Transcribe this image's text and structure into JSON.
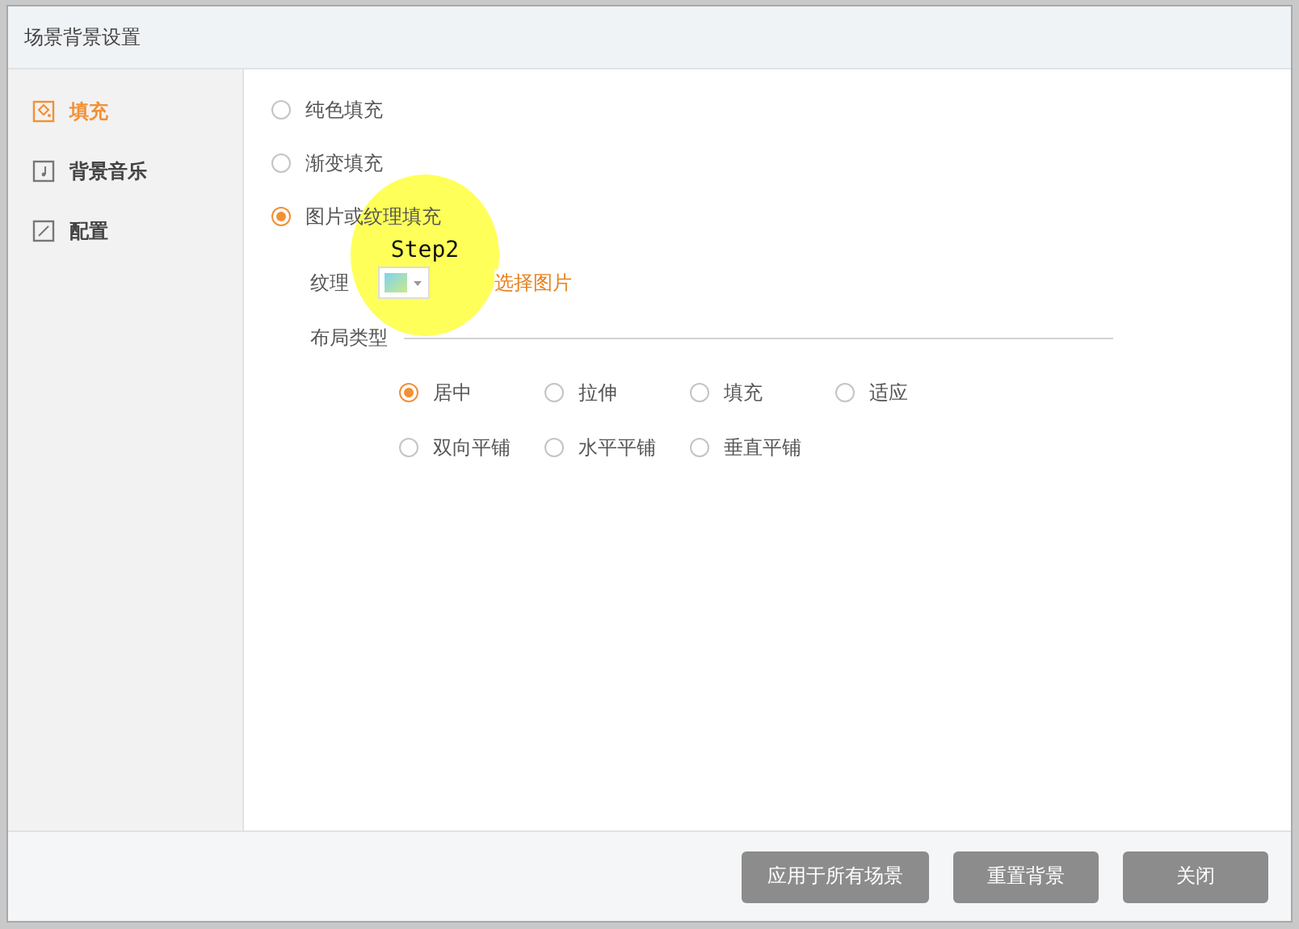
{
  "window": {
    "title": "场景背景设置"
  },
  "sidebar": {
    "items": [
      {
        "label": "填充",
        "selected": true
      },
      {
        "label": "背景音乐",
        "selected": false
      },
      {
        "label": "配置",
        "selected": false
      }
    ]
  },
  "fill_options": [
    {
      "label": "纯色填充",
      "selected": false
    },
    {
      "label": "渐变填充",
      "selected": false
    },
    {
      "label": "图片或纹理填充",
      "selected": true
    }
  ],
  "texture": {
    "label": "纹理",
    "link": "选择图片"
  },
  "layout_type": {
    "label": "布局类型",
    "options": [
      {
        "label": "居中",
        "selected": true
      },
      {
        "label": "拉伸",
        "selected": false
      },
      {
        "label": "填充",
        "selected": false
      },
      {
        "label": "适应",
        "selected": false
      },
      {
        "label": "双向平铺",
        "selected": false
      },
      {
        "label": "水平平铺",
        "selected": false
      },
      {
        "label": "垂直平铺",
        "selected": false
      }
    ]
  },
  "buttons": [
    "应用于所有场景",
    "重置背景",
    "关闭"
  ],
  "annotation": {
    "text": "Step2"
  }
}
